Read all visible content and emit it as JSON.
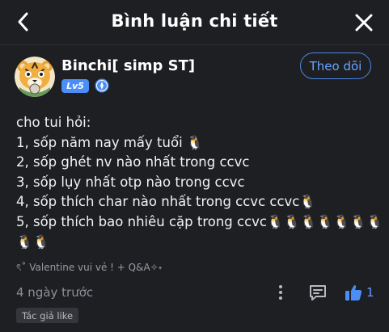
{
  "header": {
    "title": "Bình luận chi tiết"
  },
  "comment": {
    "author": {
      "name": "Binchi[ simp ST]",
      "level": "Lv5"
    },
    "follow_label": "Theo dõi",
    "lines": [
      "cho tui hỏi:",
      "1, sốp năm nay mấy tuổi 🐧",
      "2, sốp ghét nv nào nhất trong ccvc",
      "3, sốp lụy nhất otp nào trong ccvc",
      "4, sốp thích char nào nhất trong ccvc ccvc🐧",
      "5, sốp thích bao nhiêu cặp trong ccvc🐧🐧🐧🐧🐧🐧🐧",
      "🐧🐧"
    ],
    "tagline": "ৎ˚ Valentine vui vẻ ! + Q&A✧˖",
    "timestamp": "4 ngày trước",
    "like_count": "1",
    "author_tag": "Tác giả like"
  },
  "colors": {
    "background": "#1e1f23",
    "accent": "#4c8ef7",
    "muted_text": "#8e8f94"
  },
  "icons": {
    "back": "chevron-left-icon",
    "close": "close-icon",
    "verify": "verified-badge-icon",
    "more": "more-vertical-icon",
    "reply": "comment-icon",
    "like": "thumbs-up-icon"
  }
}
